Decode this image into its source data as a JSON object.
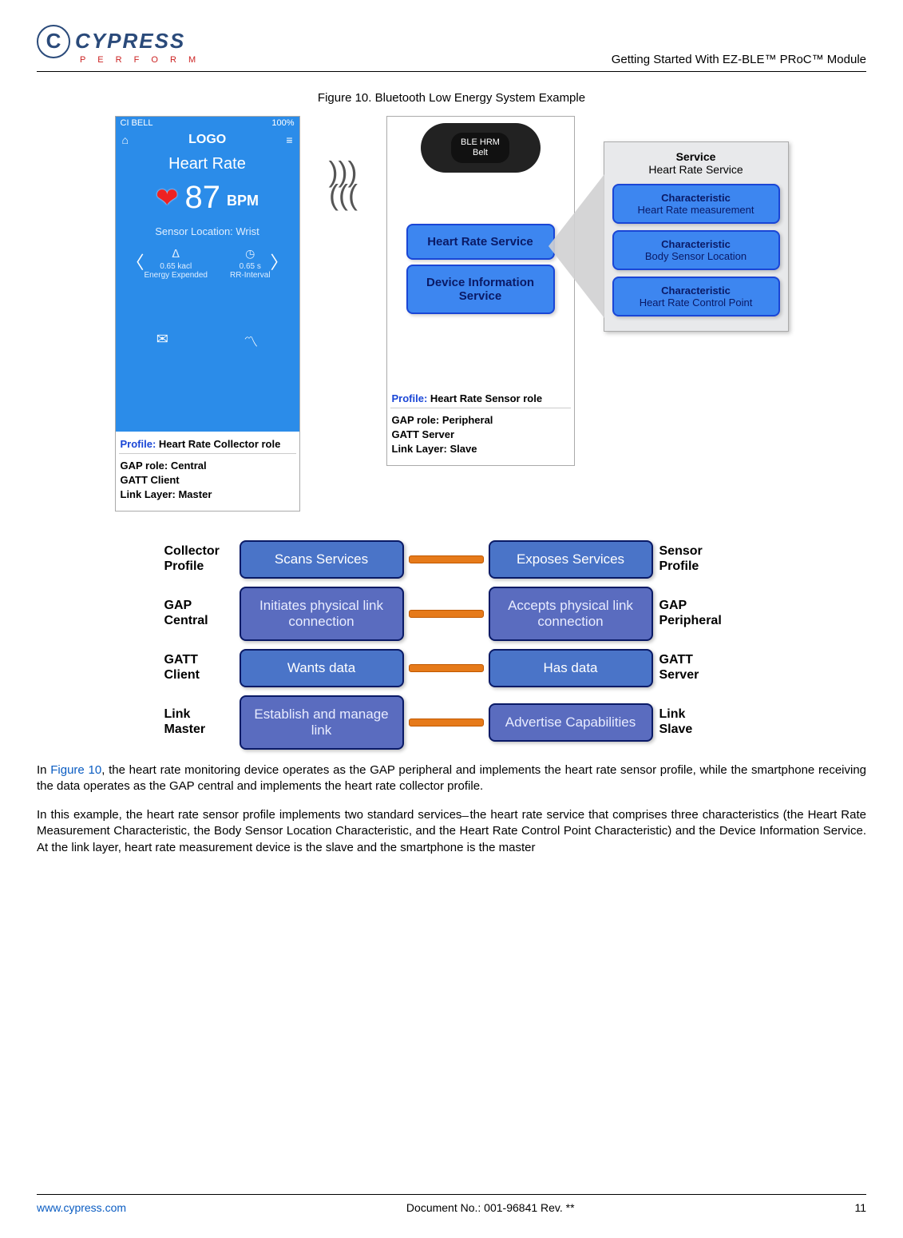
{
  "header": {
    "brand_name": "CYPRESS",
    "brand_tag": "P E R F O R M",
    "doc_title": "Getting Started With EZ-BLE™ PRoC™ Module"
  },
  "figure_caption": "Figure 10. Bluetooth Low Energy System Example",
  "phone": {
    "status_left": "CI  BELL",
    "status_right": "100%",
    "logo": "LOGO",
    "heart_rate_label": "Heart Rate",
    "heart_rate_value": "87",
    "heart_rate_unit": "BPM",
    "sensor_location": "Sensor Location: Wrist",
    "metric1_val": "0.65 kacl",
    "metric1_lbl": "Energy Expended",
    "metric2_val": "0.65 s",
    "metric2_lbl": "RR-Interval",
    "profile_prefix": "Profile:",
    "profile_text": " Heart Rate Collector role",
    "gap_role": "GAP role: Central",
    "gatt_role": "GATT Client",
    "link_layer": "Link Layer: Master"
  },
  "sensor": {
    "belt_line1": "BLE HRM",
    "belt_line2": "Belt",
    "svc1": "Heart Rate Service",
    "svc2": "Device Information Service",
    "profile_prefix": "Profile:",
    "profile_text": " Heart Rate Sensor role",
    "gap_role": "GAP role: Peripheral",
    "gatt_role": "GATT Server",
    "link_layer": "Link Layer: Slave"
  },
  "service_panel": {
    "title_bold": "Service",
    "title_sub": "Heart Rate Service",
    "char1_b": "Characteristic",
    "char1_t": "Heart Rate measurement",
    "char2_b": "Characteristic",
    "char2_t": "Body Sensor Location",
    "char3_b": "Characteristic",
    "char3_t": "Heart Rate Control Point"
  },
  "matrix": {
    "rows": [
      {
        "left_lbl": "Collector Profile",
        "left_btn": "Scans Services",
        "right_btn": "Exposes Services",
        "right_lbl": "Sensor Profile"
      },
      {
        "left_lbl": "GAP Central",
        "left_btn": "Initiates physical link connection",
        "right_btn": "Accepts physical link connection",
        "right_lbl": "GAP Peripheral"
      },
      {
        "left_lbl": "GATT Client",
        "left_btn": "Wants data",
        "right_btn": "Has data",
        "right_lbl": "GATT Server"
      },
      {
        "left_lbl": "Link Master",
        "left_btn": "Establish and manage link",
        "right_btn": "Advertise Capabilities",
        "right_lbl": "Link Slave"
      }
    ]
  },
  "body": {
    "p1_a": "In ",
    "p1_link": "Figure 10",
    "p1_b": ", the heart rate monitoring device operates as the GAP peripheral and implements the heart rate sensor profile, while the smartphone receiving the data operates as the GAP central and implements the heart rate collector profile.",
    "p2": "In this example, the heart rate sensor profile implements two standard services ̶ the heart rate service that comprises three characteristics (the Heart Rate Measurement Characteristic, the Body Sensor Location Characteristic, and the Heart Rate Control Point Characteristic) and the Device Information Service. At the link layer, heart rate measurement device is the slave and the smartphone is the master"
  },
  "footer": {
    "site": "www.cypress.com",
    "docno": "Document No.: 001-96841 Rev. **",
    "page": "11"
  }
}
